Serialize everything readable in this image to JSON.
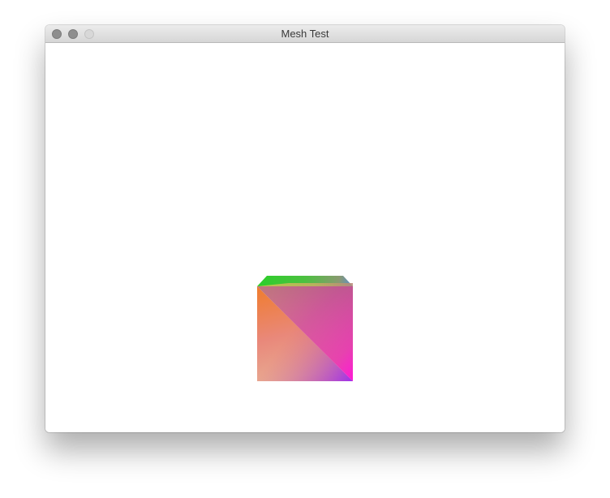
{
  "window": {
    "title": "Mesh Test",
    "controls": [
      {
        "name": "close",
        "icon": "close-icon"
      },
      {
        "name": "minimize",
        "icon": "minimize-icon"
      },
      {
        "name": "zoom",
        "icon": "zoom-icon"
      }
    ]
  },
  "scene": {
    "object": "cube",
    "face_colors": {
      "orange": "#f08030",
      "peach": "#e8a890",
      "magenta": "#ff20d0",
      "violet": "#9c20f0",
      "green": "#22cc30",
      "yellow": "#c0c850",
      "blue": "#5890c8",
      "pink": "#e05aa0"
    }
  }
}
